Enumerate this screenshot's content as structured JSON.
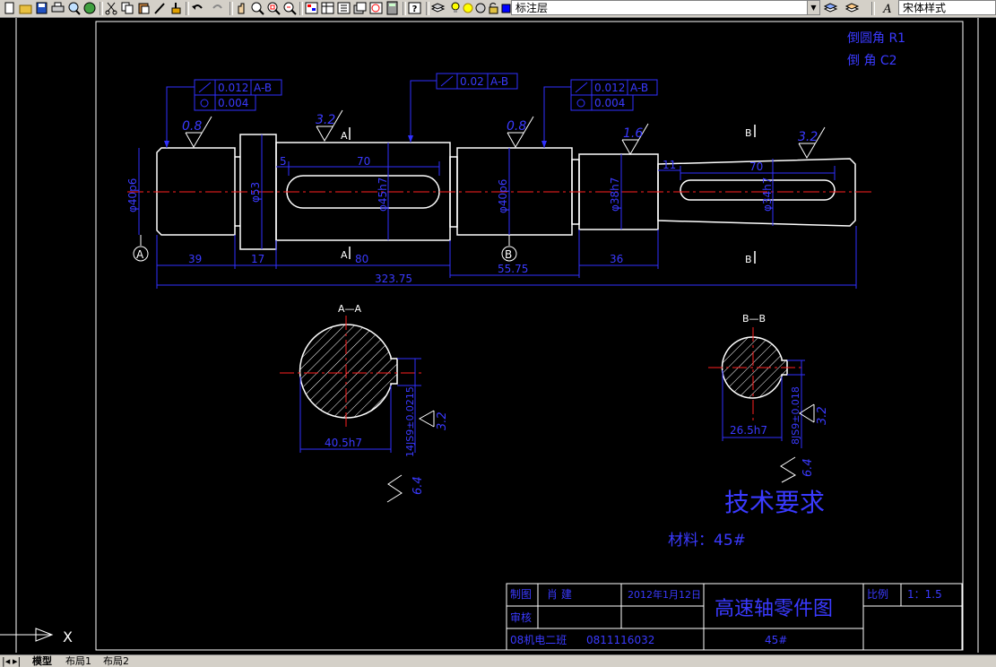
{
  "toolbar": {
    "icons": [
      "new-icon",
      "open-icon",
      "save-icon",
      "print-icon",
      "preview-icon",
      "publish-icon",
      "cut-icon",
      "copy-icon",
      "paste-icon",
      "match-icon",
      "paint-icon",
      "undo-icon",
      "redo-icon",
      "pan-icon",
      "zoom-realtime-icon",
      "zoom-window-icon",
      "zoom-previous-icon",
      "properties-icon",
      "design-center-icon",
      "tool-palette-icon",
      "sheet-set-icon",
      "markup-icon",
      "calculator-icon",
      "help-icon",
      "layer-manager-icon",
      "bulb-icon",
      "sun-icon",
      "freeze-icon",
      "lock-icon",
      "color-icon"
    ],
    "layer_combo": "标注层",
    "text_style_combo": "宋体样式"
  },
  "colors": {
    "background": "#000000",
    "frame": "#ffffff",
    "dimension": "#3030ff",
    "centerline": "#ff2020",
    "text_blue": "#3a3aff"
  },
  "drawing": {
    "chamfer_r": "倒圆角 R1",
    "chamfer_c": "倒   角 C2",
    "gdt": {
      "left_runout": "0.012",
      "left_runout_ref": "A-B",
      "left_cyl": "0.004",
      "mid_runout": "0.02",
      "mid_runout_ref": "A-B",
      "right_runout": "0.012",
      "right_runout_ref": "A-B",
      "right_cyl": "0.004"
    },
    "roughness": {
      "r1": "0.8",
      "r2": "3.2",
      "r3": "0.8",
      "r4": "1.6",
      "r5": "3.2"
    },
    "diameters": {
      "d1": "φ40p6",
      "d2": "φ53",
      "d3": "φ45h7",
      "d4": "φ40p6",
      "d5": "φ38h7",
      "d6": "φ34h7"
    },
    "keyway": {
      "dim_5": "5",
      "len_left": "70",
      "dim_11": "11",
      "len_right": "70"
    },
    "lengths": {
      "l39": "39",
      "l17": "17",
      "l80": "80",
      "l36": "36",
      "total": "323.75",
      "l5575": "55.75"
    },
    "datum_a": "A",
    "datum_b": "B",
    "section_mark_a": "A",
    "section_mark_b": "B",
    "section_a": {
      "title": "A—A",
      "width": "40.5h7",
      "key": "14JS9±0.0215",
      "ra1": "3.2",
      "ra2": "6.4"
    },
    "section_b": {
      "title": "B—B",
      "width": "26.5h7",
      "key": "8JS9±0.018",
      "ra1": "3.2",
      "ra2": "6.4"
    },
    "tech_req": "技术要求",
    "material": "材料：45#"
  },
  "title_block": {
    "drawn_label": "制图",
    "drawn_by": "肖  建",
    "date": "2012年1月12日",
    "review_label": "审核",
    "drawing_title": "高速轴零件图",
    "scale_label": "比例",
    "scale_value": "1：1.5",
    "class": "08机电二班",
    "student_id": "0811116032",
    "material": "45#"
  },
  "ucs_label": "X",
  "tabs": {
    "model": "模型",
    "layout1": "布局1",
    "layout2": "布局2"
  }
}
